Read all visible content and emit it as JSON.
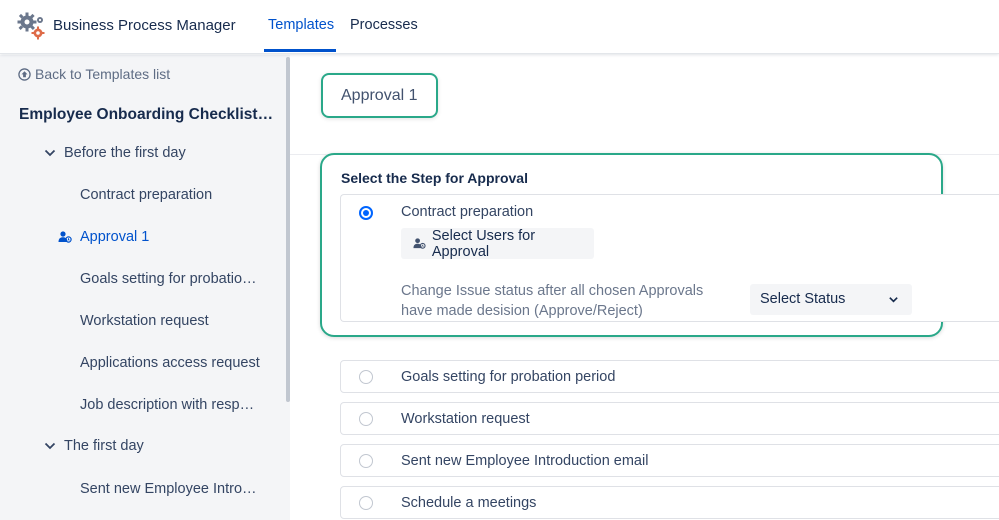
{
  "app": {
    "title": "Business Process Manager"
  },
  "nav": {
    "tabs": [
      {
        "label": "Templates",
        "active": true
      },
      {
        "label": "Processes",
        "active": false
      }
    ]
  },
  "sidebar": {
    "back_label": "Back to Templates list",
    "template_title": "Employee Onboarding Checklist - w...",
    "sections": [
      {
        "label": "Before the first day",
        "expanded": true,
        "items": [
          {
            "label": "Contract preparation",
            "active": false
          },
          {
            "label": "Approval 1",
            "active": true,
            "icon": "users-icon"
          },
          {
            "label": "Goals setting for probation ...",
            "active": false
          },
          {
            "label": "Workstation request",
            "active": false
          },
          {
            "label": "Applications access request",
            "active": false
          },
          {
            "label": "Job description with respon...",
            "active": false
          }
        ]
      },
      {
        "label": "The first day",
        "expanded": true,
        "items": [
          {
            "label": "Sent new Employee Introduc...",
            "active": false
          }
        ]
      }
    ]
  },
  "main": {
    "step_name": "Approval 1",
    "section_label": "Select the Step for Approval",
    "selected_step": {
      "label": "Contract preparation",
      "select_users_label": "Select Users for Approval",
      "status_description": "Change Issue status after all chosen Approvals have made desision (Approve/Reject)",
      "status_select_value": "Select Status"
    },
    "other_steps": [
      "Goals setting for probation period",
      "Workstation request",
      "Sent new Employee Introduction email",
      "Schedule a meetings"
    ]
  },
  "colors": {
    "accent": "#0052cc",
    "highlight": "#2aa889",
    "radio": "#0065ff",
    "sidebar_bg": "#f4f5f7"
  }
}
